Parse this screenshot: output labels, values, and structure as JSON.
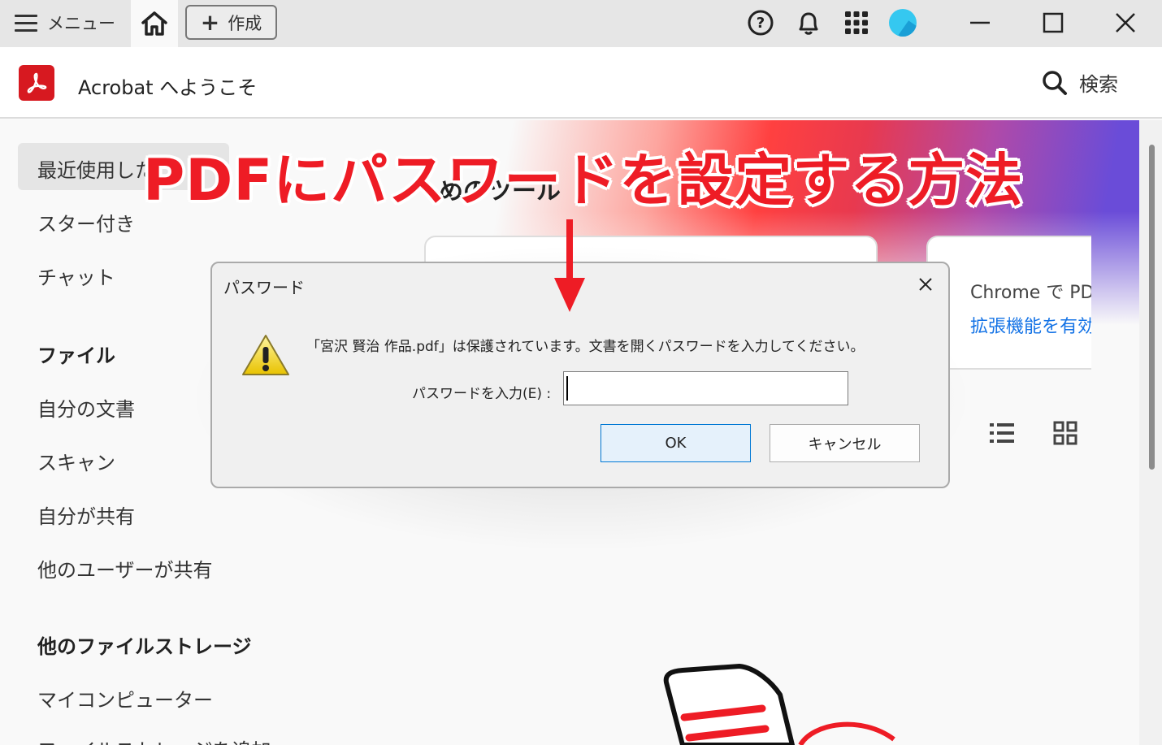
{
  "topbar": {
    "menu_label": "メニュー",
    "create_label": "作成"
  },
  "header": {
    "app_title": "Acrobat へようこそ",
    "search_label": "検索"
  },
  "sidebar": {
    "items": [
      {
        "label": "最近使用した"
      },
      {
        "label": "スター付き"
      },
      {
        "label": "チャット"
      }
    ],
    "file_section": "ファイル",
    "file_items": [
      {
        "label": "自分の文書"
      },
      {
        "label": "スキャン"
      },
      {
        "label": "自分が共有"
      },
      {
        "label": "他のユーザーが共有"
      }
    ],
    "storage_section": "他のファイルストレージ",
    "storage_items": [
      {
        "label": "マイコンピューター"
      },
      {
        "label": "ファイルストレージを追加"
      }
    ]
  },
  "main": {
    "hero_heading": "めのツール",
    "card2_line1": "Chrome で PDF",
    "card2_line2": "拡張機能を有効"
  },
  "dialog": {
    "title": "パスワード",
    "message": "「宮沢 賢治 作品.pdf」は保護されています。文書を開くパスワードを入力してください。",
    "password_label": "パスワードを入力(E) :",
    "password_value": "",
    "ok_label": "OK",
    "cancel_label": "キャンセル"
  },
  "overlay": {
    "banner_text": "PDFにパスワードを設定する方法"
  },
  "colors": {
    "acrobat_red": "#d71920",
    "banner_red": "#ee1c25",
    "link_blue": "#1473e6",
    "ok_border": "#0078d4"
  }
}
